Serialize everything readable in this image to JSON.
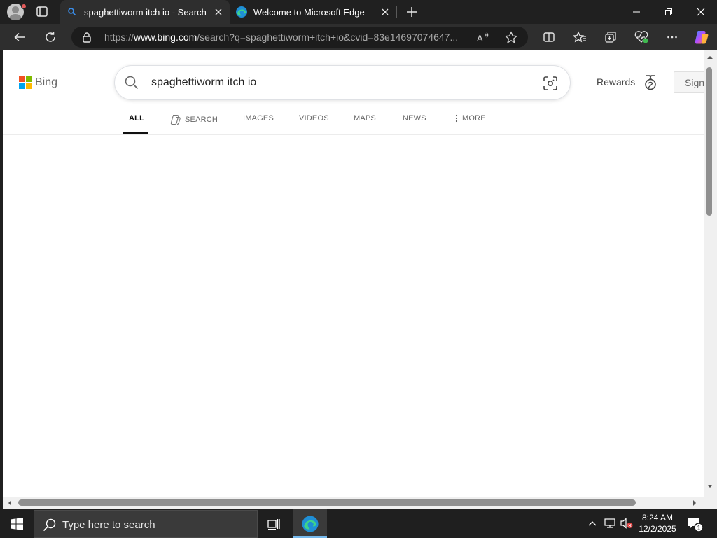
{
  "browser": {
    "tabs": [
      {
        "title": "spaghettiworm itch io - Search",
        "active": true,
        "favicon": "bing-search-icon"
      },
      {
        "title": "Welcome to Microsoft Edge",
        "active": false,
        "favicon": "edge-icon"
      }
    ],
    "address": {
      "prefix": "https://",
      "domain": "www.bing.com",
      "rest": "/search?q=spaghettiworm+itch+io&cvid=83e14697074647..."
    }
  },
  "page": {
    "logo_text": "Bing",
    "search": {
      "query": "spaghettiworm itch io"
    },
    "rewards_label": "Rewards",
    "signin_label": "Sign in",
    "nav": [
      {
        "label": "ALL",
        "active": true
      },
      {
        "label": "SEARCH",
        "active": false
      },
      {
        "label": "IMAGES",
        "active": false
      },
      {
        "label": "VIDEOS",
        "active": false
      },
      {
        "label": "MAPS",
        "active": false
      },
      {
        "label": "NEWS",
        "active": false
      },
      {
        "label": "MORE",
        "active": false
      }
    ]
  },
  "taskbar": {
    "search_placeholder": "Type here to search",
    "time": "8:24 AM",
    "date": "12/2/2025",
    "notification_count": "1"
  },
  "colors": {
    "accent": "#0078d4",
    "bing_red": "#f25022",
    "bing_green": "#7fba00",
    "bing_blue": "#00a4ef",
    "bing_yellow": "#ffb900"
  }
}
